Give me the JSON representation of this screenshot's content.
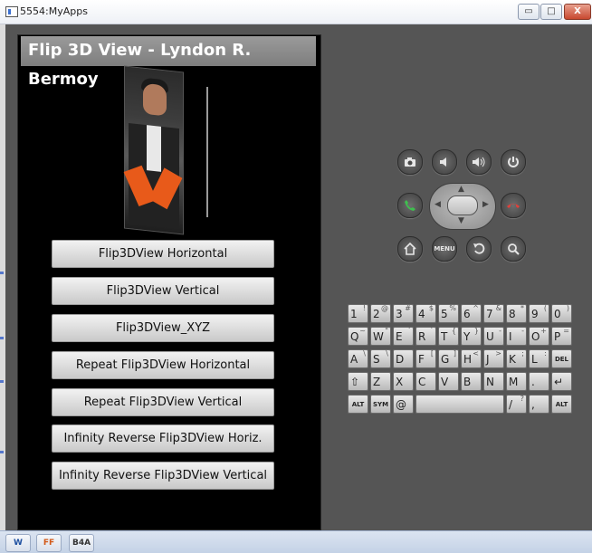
{
  "window": {
    "title": "5554:MyApps",
    "controls": {
      "minimize": "▭",
      "maximize": "□",
      "close": "X"
    }
  },
  "app": {
    "title": "Flip 3D View - Lyndon R. Bermoy",
    "buttons": [
      "Flip3DView Horizontal",
      "Flip3DView Vertical",
      "Flip3DView_XYZ",
      "Repeat Flip3DView Horizontal",
      "Repeat Flip3DView Vertical",
      "Infinity Reverse Flip3DView Horiz.",
      "Infinity Reverse Flip3DView Vertical"
    ]
  },
  "hardware_buttons": {
    "camera": "camera-icon",
    "volume_down": "volume-down-icon",
    "volume_up": "volume-up-icon",
    "power": "power-icon",
    "call": "call-icon",
    "end_call": "end-call-icon",
    "home": "home-icon",
    "menu_label": "MENU",
    "back": "back-icon",
    "search": "search-icon"
  },
  "keyboard": {
    "row1": [
      [
        "1",
        "!"
      ],
      [
        "2",
        "@"
      ],
      [
        "3",
        "#"
      ],
      [
        "4",
        "$"
      ],
      [
        "5",
        "%"
      ],
      [
        "6",
        "^"
      ],
      [
        "7",
        "&"
      ],
      [
        "8",
        "*"
      ],
      [
        "9",
        "("
      ],
      [
        "0",
        ")"
      ]
    ],
    "row2": [
      [
        "Q",
        "~"
      ],
      [
        "W",
        "\""
      ],
      [
        "E",
        "´"
      ],
      [
        "R",
        "`"
      ],
      [
        "T",
        "{"
      ],
      [
        "Y",
        "}"
      ],
      [
        "U",
        "-"
      ],
      [
        "I",
        "-"
      ],
      [
        "O",
        "+"
      ],
      [
        "P",
        "="
      ]
    ],
    "row3": [
      [
        "A",
        "\\"
      ],
      [
        "S",
        "\\"
      ],
      [
        "D",
        ""
      ],
      [
        "F",
        "["
      ],
      [
        "G",
        "]"
      ],
      [
        "H",
        "<"
      ],
      [
        "J",
        ">"
      ],
      [
        "K",
        ";"
      ],
      [
        "L",
        ":"
      ],
      [
        "DEL",
        ""
      ]
    ],
    "row4": [
      [
        "⇧",
        ""
      ],
      [
        "Z",
        ""
      ],
      [
        "X",
        ""
      ],
      [
        "C",
        ""
      ],
      [
        "V",
        ""
      ],
      [
        "B",
        ""
      ],
      [
        "N",
        ""
      ],
      [
        "M",
        ""
      ],
      [
        ".",
        ""
      ],
      [
        "↵",
        ""
      ]
    ],
    "row5": [
      [
        "ALT",
        ""
      ],
      [
        "SYM",
        ""
      ],
      [
        "@",
        ""
      ],
      [
        "",
        ""
      ],
      [
        "/",
        "?"
      ],
      [
        ",",
        ""
      ],
      [
        "ALT",
        ""
      ]
    ]
  },
  "taskbar": {
    "items": [
      "W",
      "FF",
      "B4A"
    ]
  }
}
